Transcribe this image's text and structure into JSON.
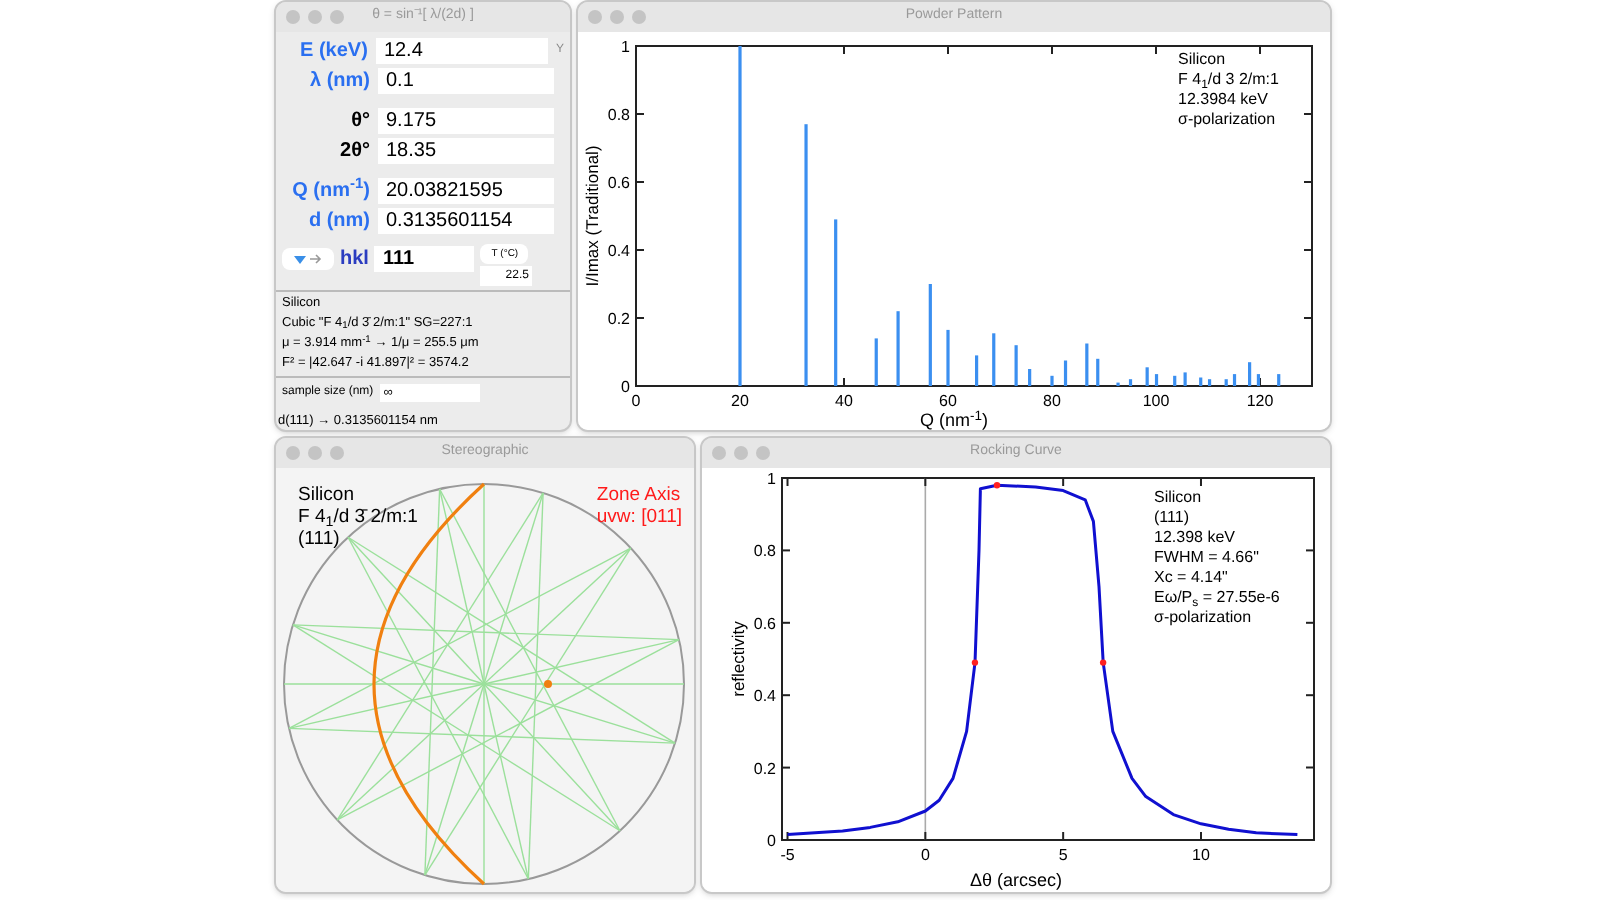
{
  "calculator": {
    "title": "θ = sin⁻¹[ λ/(2d) ]",
    "fields": [
      {
        "label": "E (keV)",
        "value": "12.4",
        "kind": "input"
      },
      {
        "label": "λ (nm)",
        "value": "0.1",
        "kind": "input"
      },
      {
        "label": "θ°",
        "value": "9.175",
        "kind": "output"
      },
      {
        "label": "2θ°",
        "value": "18.35",
        "kind": "output"
      },
      {
        "label": "Q (nm$^{-1}$)",
        "value": "20.03821595",
        "kind": "input"
      },
      {
        "label": "d (nm)",
        "value": "0.3135601154",
        "kind": "input"
      }
    ],
    "side_mark": "Y",
    "hkl": {
      "label": "hkl",
      "value": "111"
    },
    "temperature": {
      "button": "T (°C)",
      "value": "22.5"
    },
    "info": [
      "Silicon",
      "Cubic   \"F 4$_{1}$/d 3̄ 2/m:1\"   SG=227:1",
      "μ = 3.914 mm$^{-1}$ → 1/μ = 255.5 μm",
      "F² = |42.647 -i 41.897|² = 3574.2"
    ],
    "sample_size": {
      "label": "sample size (nm)",
      "value": "∞"
    },
    "status": "d(111) → 0.3135601154 nm"
  },
  "powder": {
    "title": "Powder Pattern",
    "legend": [
      "Silicon",
      "F 4$_{1}$/d 3 2/m:1",
      "12.3984 keV",
      "σ-polarization"
    ],
    "chart_data": {
      "type": "bar",
      "xlabel": "Q (nm$^{-1}$)",
      "ylabel": "I/Imax  (Traditional)",
      "x": [
        20,
        32.7,
        38.4,
        46.2,
        50.4,
        56.6,
        60,
        65.5,
        68.8,
        73.1,
        75.7,
        80,
        82.6,
        86.7,
        88.8,
        92.7,
        95.1,
        98.3,
        100.1,
        103.6,
        105.6,
        108.6,
        110.3,
        113.5,
        115.1,
        118,
        119.7,
        123.6
      ],
      "series": [
        {
          "color": "#3b8ff0",
          "values": [
            1,
            0.77,
            0.49,
            0.14,
            0.22,
            0.3,
            0.165,
            0.09,
            0.155,
            0.12,
            0.05,
            0.03,
            0.075,
            0.125,
            0.08,
            0.01,
            0.02,
            0.055,
            0.035,
            0.03,
            0.04,
            0.025,
            0.02,
            0.02,
            0.035,
            0.07,
            0.035,
            0.035
          ]
        }
      ],
      "xlim": [
        0,
        130
      ],
      "ylim": [
        0,
        1
      ],
      "xticks": [
        0,
        20,
        40,
        60,
        80,
        100,
        120
      ],
      "yticks": [
        0,
        0.2,
        0.4,
        0.6,
        0.8,
        1
      ]
    }
  },
  "stereo": {
    "title": "Stereographic",
    "crystal": [
      "Silicon",
      "F 4$_{1}$/d 3̄ 2/m:1",
      "(111)"
    ],
    "zone": [
      "Zone Axis",
      "uvw: [011]"
    ]
  },
  "rocking": {
    "title": "Rocking Curve",
    "legend": [
      "Silicon",
      "(111)",
      "12.398 keV",
      "FWHM = 4.66\"",
      "Xc = 4.14\"",
      "Eω/P$_{s}$ = 27.55e-6",
      "σ-polarization"
    ],
    "chart_data": {
      "type": "line",
      "xlabel": "Δθ (arcsec)",
      "ylabel": "reflectivity",
      "x": [
        -5,
        -4,
        -3,
        -2,
        -1,
        0,
        0.5,
        1,
        1.5,
        1.8,
        1.95,
        2,
        2.6,
        4,
        5,
        5.8,
        6.1,
        6.3,
        6.45,
        6.8,
        7.5,
        8,
        9,
        10,
        11,
        12,
        13.5
      ],
      "series": [
        {
          "color": "#1010d0",
          "values": [
            0.015,
            0.02,
            0.025,
            0.035,
            0.05,
            0.08,
            0.11,
            0.17,
            0.3,
            0.49,
            0.8,
            0.97,
            0.98,
            0.975,
            0.965,
            0.94,
            0.88,
            0.7,
            0.49,
            0.3,
            0.17,
            0.12,
            0.07,
            0.045,
            0.03,
            0.02,
            0.015
          ]
        }
      ],
      "xlim": [
        -5.2,
        14.1
      ],
      "ylim": [
        0,
        1
      ],
      "xticks": [
        -5,
        0,
        5,
        10
      ],
      "yticks": [
        0,
        0.2,
        0.4,
        0.6,
        0.8,
        1
      ]
    }
  }
}
